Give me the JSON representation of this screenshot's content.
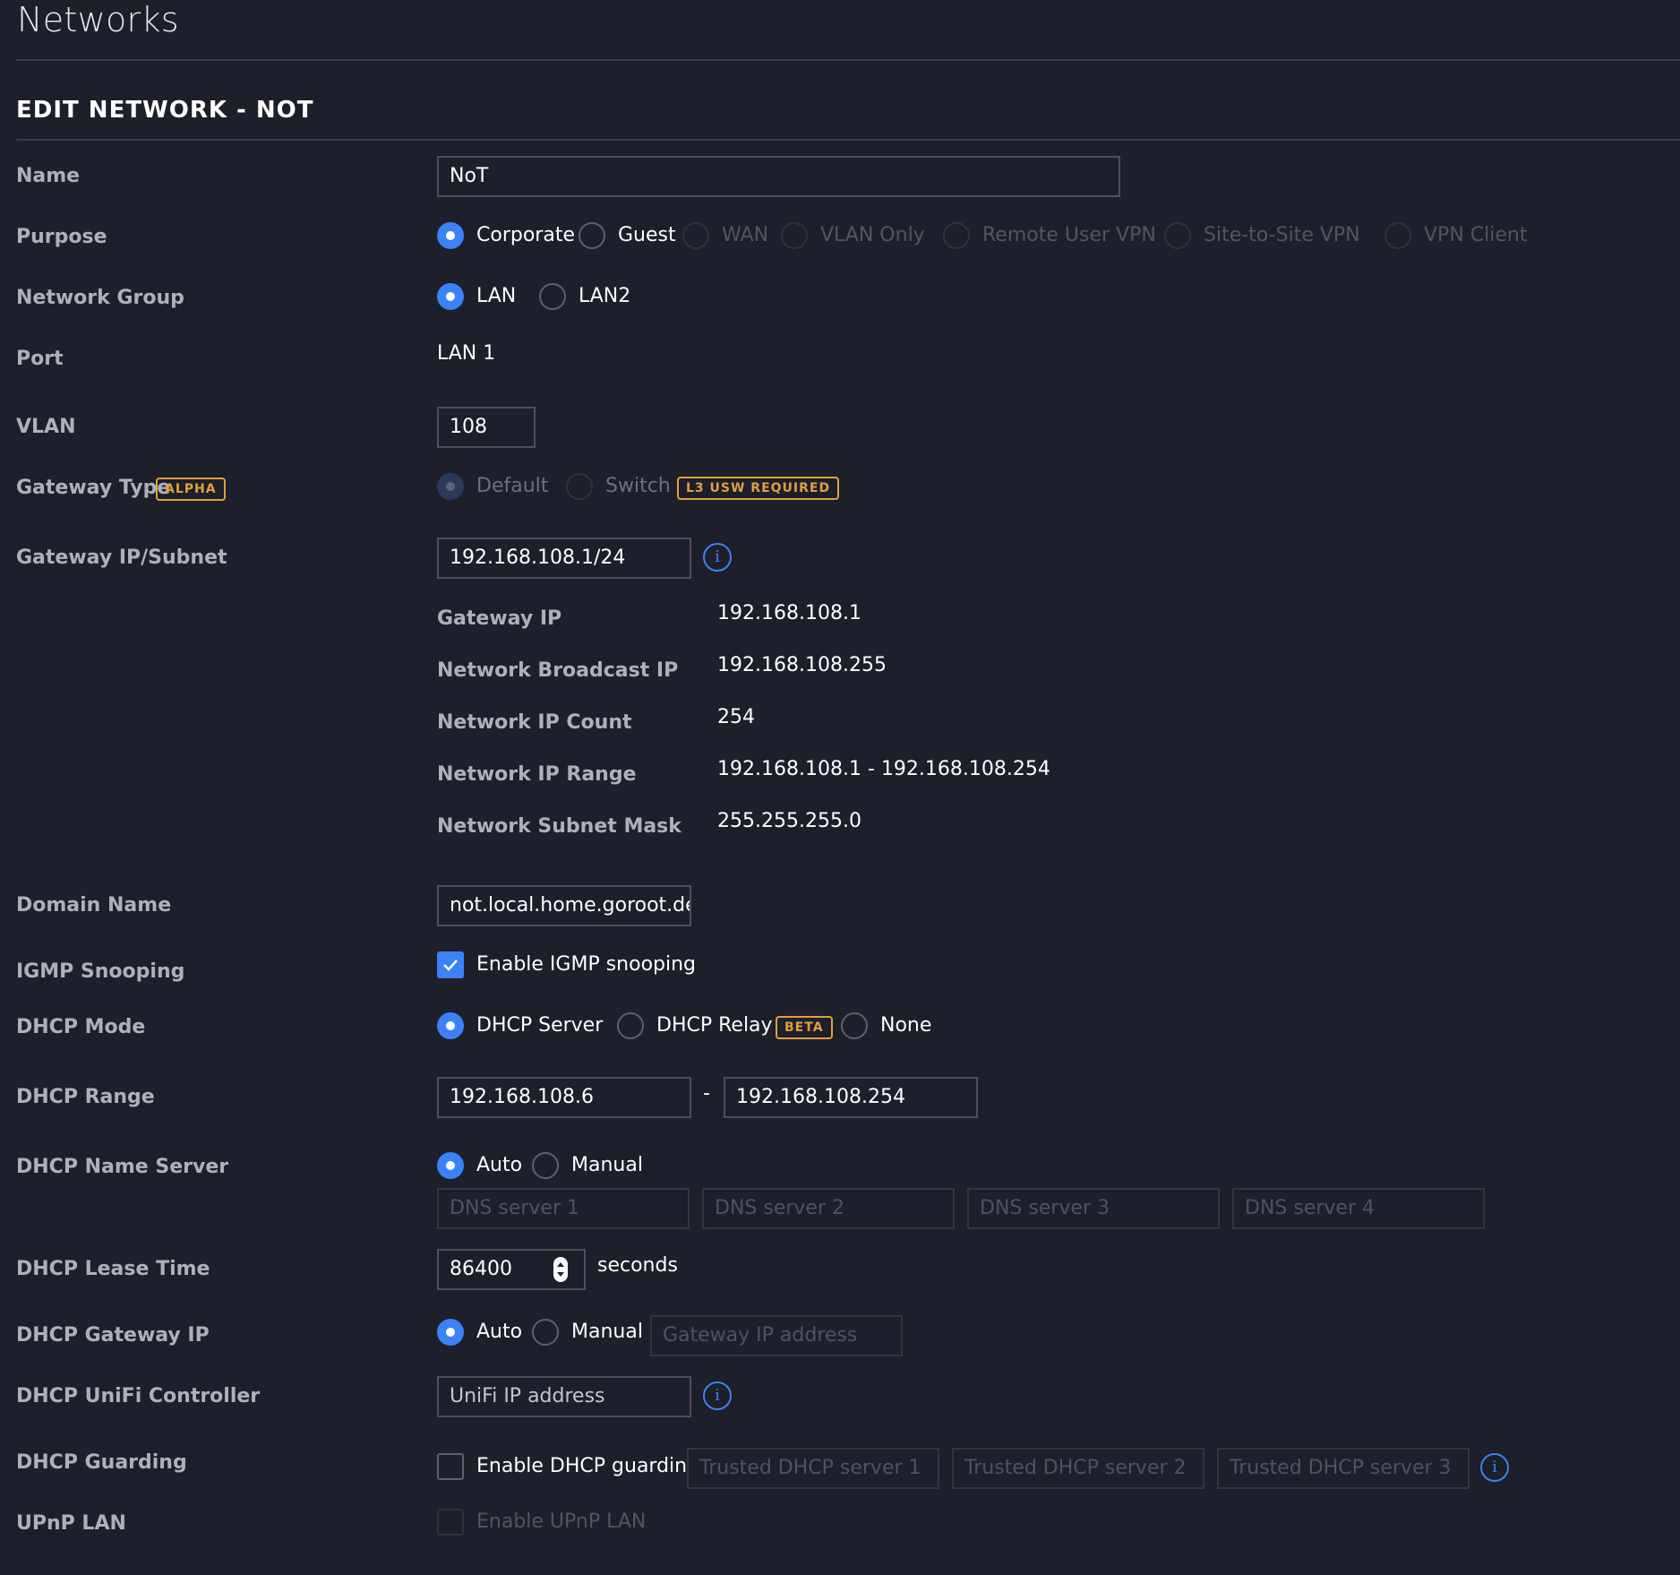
{
  "page": {
    "title": "Networks",
    "section_title": "EDIT NETWORK - NOT"
  },
  "name": {
    "label": "Name",
    "value": "NoT"
  },
  "purpose": {
    "label": "Purpose",
    "options": [
      "Corporate",
      "Guest",
      "WAN",
      "VLAN Only",
      "Remote User VPN",
      "Site-to-Site VPN",
      "VPN Client"
    ],
    "selected": "Corporate"
  },
  "network_group": {
    "label": "Network Group",
    "options": [
      "LAN",
      "LAN2"
    ],
    "selected": "LAN"
  },
  "port": {
    "label": "Port",
    "value": "LAN 1"
  },
  "vlan": {
    "label": "VLAN",
    "value": "108"
  },
  "gateway_type": {
    "label": "Gateway Type",
    "badge": "ALPHA",
    "options": [
      "Default",
      "Switch"
    ],
    "selected": "Default",
    "switch_badge": "L3 USW REQUIRED"
  },
  "gateway_subnet": {
    "label": "Gateway IP/Subnet",
    "value": "192.168.108.1/24",
    "details": {
      "gateway_ip_label": "Gateway IP",
      "gateway_ip": "192.168.108.1",
      "broadcast_label": "Network Broadcast IP",
      "broadcast": "192.168.108.255",
      "count_label": "Network IP Count",
      "count": "254",
      "range_label": "Network IP Range",
      "range": "192.168.108.1 - 192.168.108.254",
      "mask_label": "Network Subnet Mask",
      "mask": "255.255.255.0"
    }
  },
  "domain": {
    "label": "Domain Name",
    "value": "not.local.home.goroot.de"
  },
  "igmp": {
    "label": "IGMP Snooping",
    "checkbox_label": "Enable IGMP snooping",
    "checked": true
  },
  "dhcp_mode": {
    "label": "DHCP Mode",
    "options": [
      "DHCP Server",
      "DHCP Relay",
      "None"
    ],
    "relay_badge": "BETA",
    "selected": "DHCP Server"
  },
  "dhcp_range": {
    "label": "DHCP Range",
    "start": "192.168.108.6",
    "separator": "-",
    "end": "192.168.108.254"
  },
  "dhcp_name_server": {
    "label": "DHCP Name Server",
    "options": [
      "Auto",
      "Manual"
    ],
    "selected": "Auto",
    "placeholders": [
      "DNS server 1",
      "DNS server 2",
      "DNS server 3",
      "DNS server 4"
    ]
  },
  "lease": {
    "label": "DHCP Lease Time",
    "value": "86400",
    "unit": "seconds"
  },
  "dhcp_gateway": {
    "label": "DHCP Gateway IP",
    "options": [
      "Auto",
      "Manual"
    ],
    "selected": "Auto",
    "placeholder": "Gateway IP address"
  },
  "controller": {
    "label": "DHCP UniFi Controller",
    "placeholder": "UniFi IP address"
  },
  "guarding": {
    "label": "DHCP Guarding",
    "checkbox_label": "Enable DHCP guarding",
    "checked": false,
    "placeholders": [
      "Trusted DHCP server 1",
      "Trusted DHCP server 2",
      "Trusted DHCP server 3"
    ]
  },
  "upnp": {
    "label": "UPnP LAN",
    "checkbox_label": "Enable UPnP LAN",
    "checked": false
  },
  "colors": {
    "background": "#1d1f2a",
    "accent": "#3b82f6",
    "badge": "#e0a040",
    "label": "#aeb1ba"
  }
}
